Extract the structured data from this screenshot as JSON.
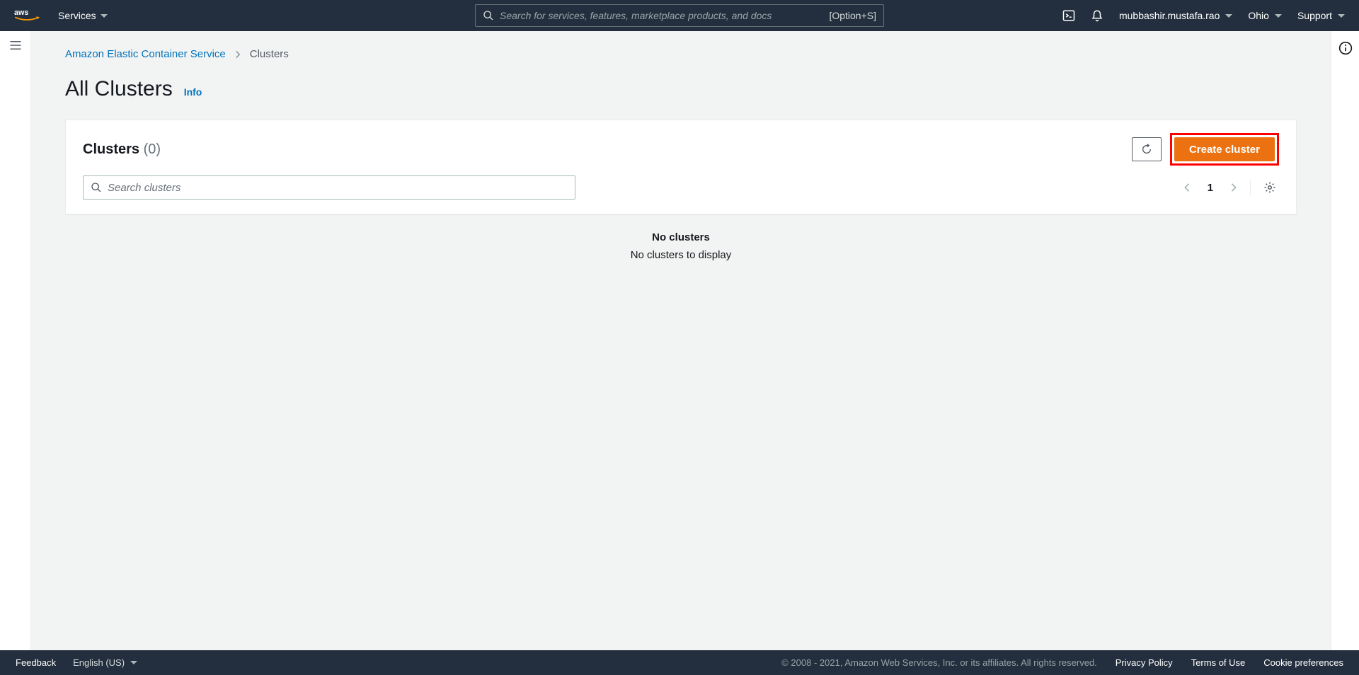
{
  "topnav": {
    "services_label": "Services",
    "search_placeholder": "Search for services, features, marketplace products, and docs",
    "search_shortcut": "[Option+S]",
    "username": "mubbashir.mustafa.rao",
    "region": "Ohio",
    "support_label": "Support"
  },
  "breadcrumbs": {
    "root": "Amazon Elastic Container Service",
    "current": "Clusters"
  },
  "page": {
    "title": "All Clusters",
    "info_label": "Info"
  },
  "card": {
    "title": "Clusters",
    "count_display": "(0)",
    "create_label": "Create cluster",
    "search_placeholder": "Search clusters",
    "page_number": "1"
  },
  "empty": {
    "heading": "No clusters",
    "sub": "No clusters to display"
  },
  "footer": {
    "feedback": "Feedback",
    "language": "English (US)",
    "copyright": "© 2008 - 2021, Amazon Web Services, Inc. or its affiliates. All rights reserved.",
    "privacy": "Privacy Policy",
    "terms": "Terms of Use",
    "cookies": "Cookie preferences"
  }
}
